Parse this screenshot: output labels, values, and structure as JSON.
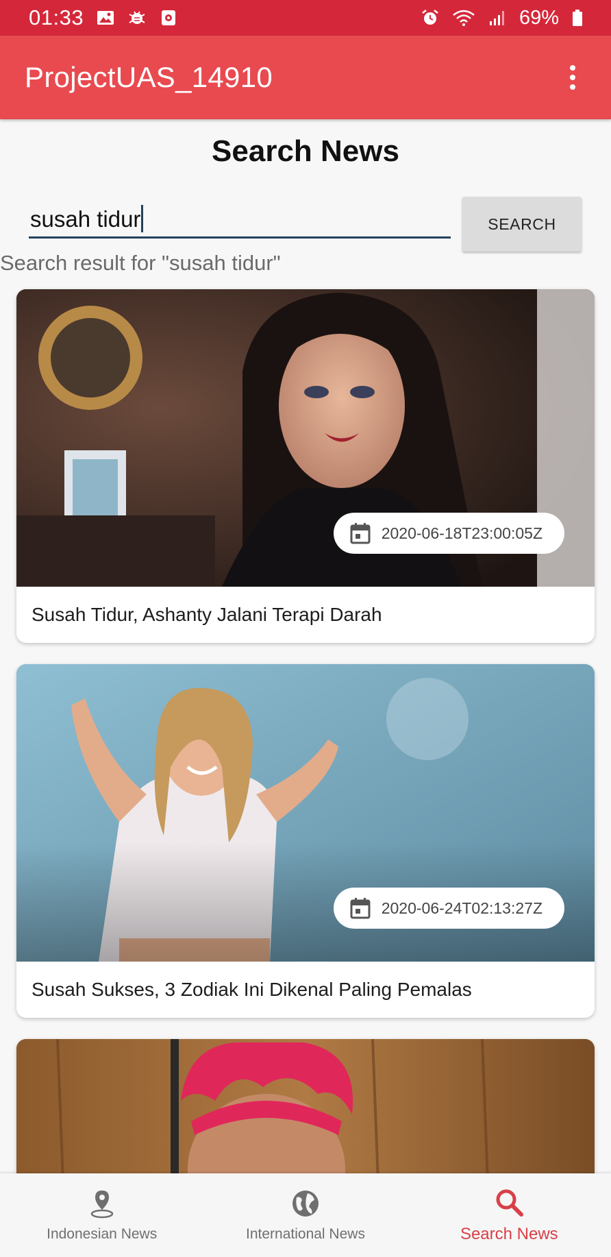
{
  "status_bar": {
    "time": "01:33",
    "battery_text": "69%",
    "left_icons": [
      "gallery-icon",
      "bug-icon",
      "record-icon"
    ],
    "right_icons": [
      "alarm-icon",
      "wifi-icon",
      "signal-icon",
      "battery-icon"
    ]
  },
  "app_bar": {
    "title": "ProjectUAS_14910",
    "overflow_icon": "more-vert-icon",
    "color": "#e84a50"
  },
  "page": {
    "title": "Search News"
  },
  "search": {
    "value": "susah tidur",
    "button_label": "SEARCH",
    "result_label": "Search result for \"susah tidur\""
  },
  "articles": [
    {
      "title": "Susah Tidur, Ashanty Jalani Terapi Darah",
      "date": "2020-06-18T23:00:05Z"
    },
    {
      "title": "Susah Sukses, 3 Zodiak Ini Dikenal Paling Pemalas",
      "date": "2020-06-24T02:13:27Z"
    },
    {
      "title": "",
      "date": ""
    }
  ],
  "bottom_nav": {
    "items": [
      {
        "label": "Indonesian News",
        "icon": "location-pin-icon",
        "active": false
      },
      {
        "label": "International News",
        "icon": "globe-icon",
        "active": false
      },
      {
        "label": "Search News",
        "icon": "search-icon",
        "active": true
      }
    ],
    "active_color": "#d84048"
  }
}
